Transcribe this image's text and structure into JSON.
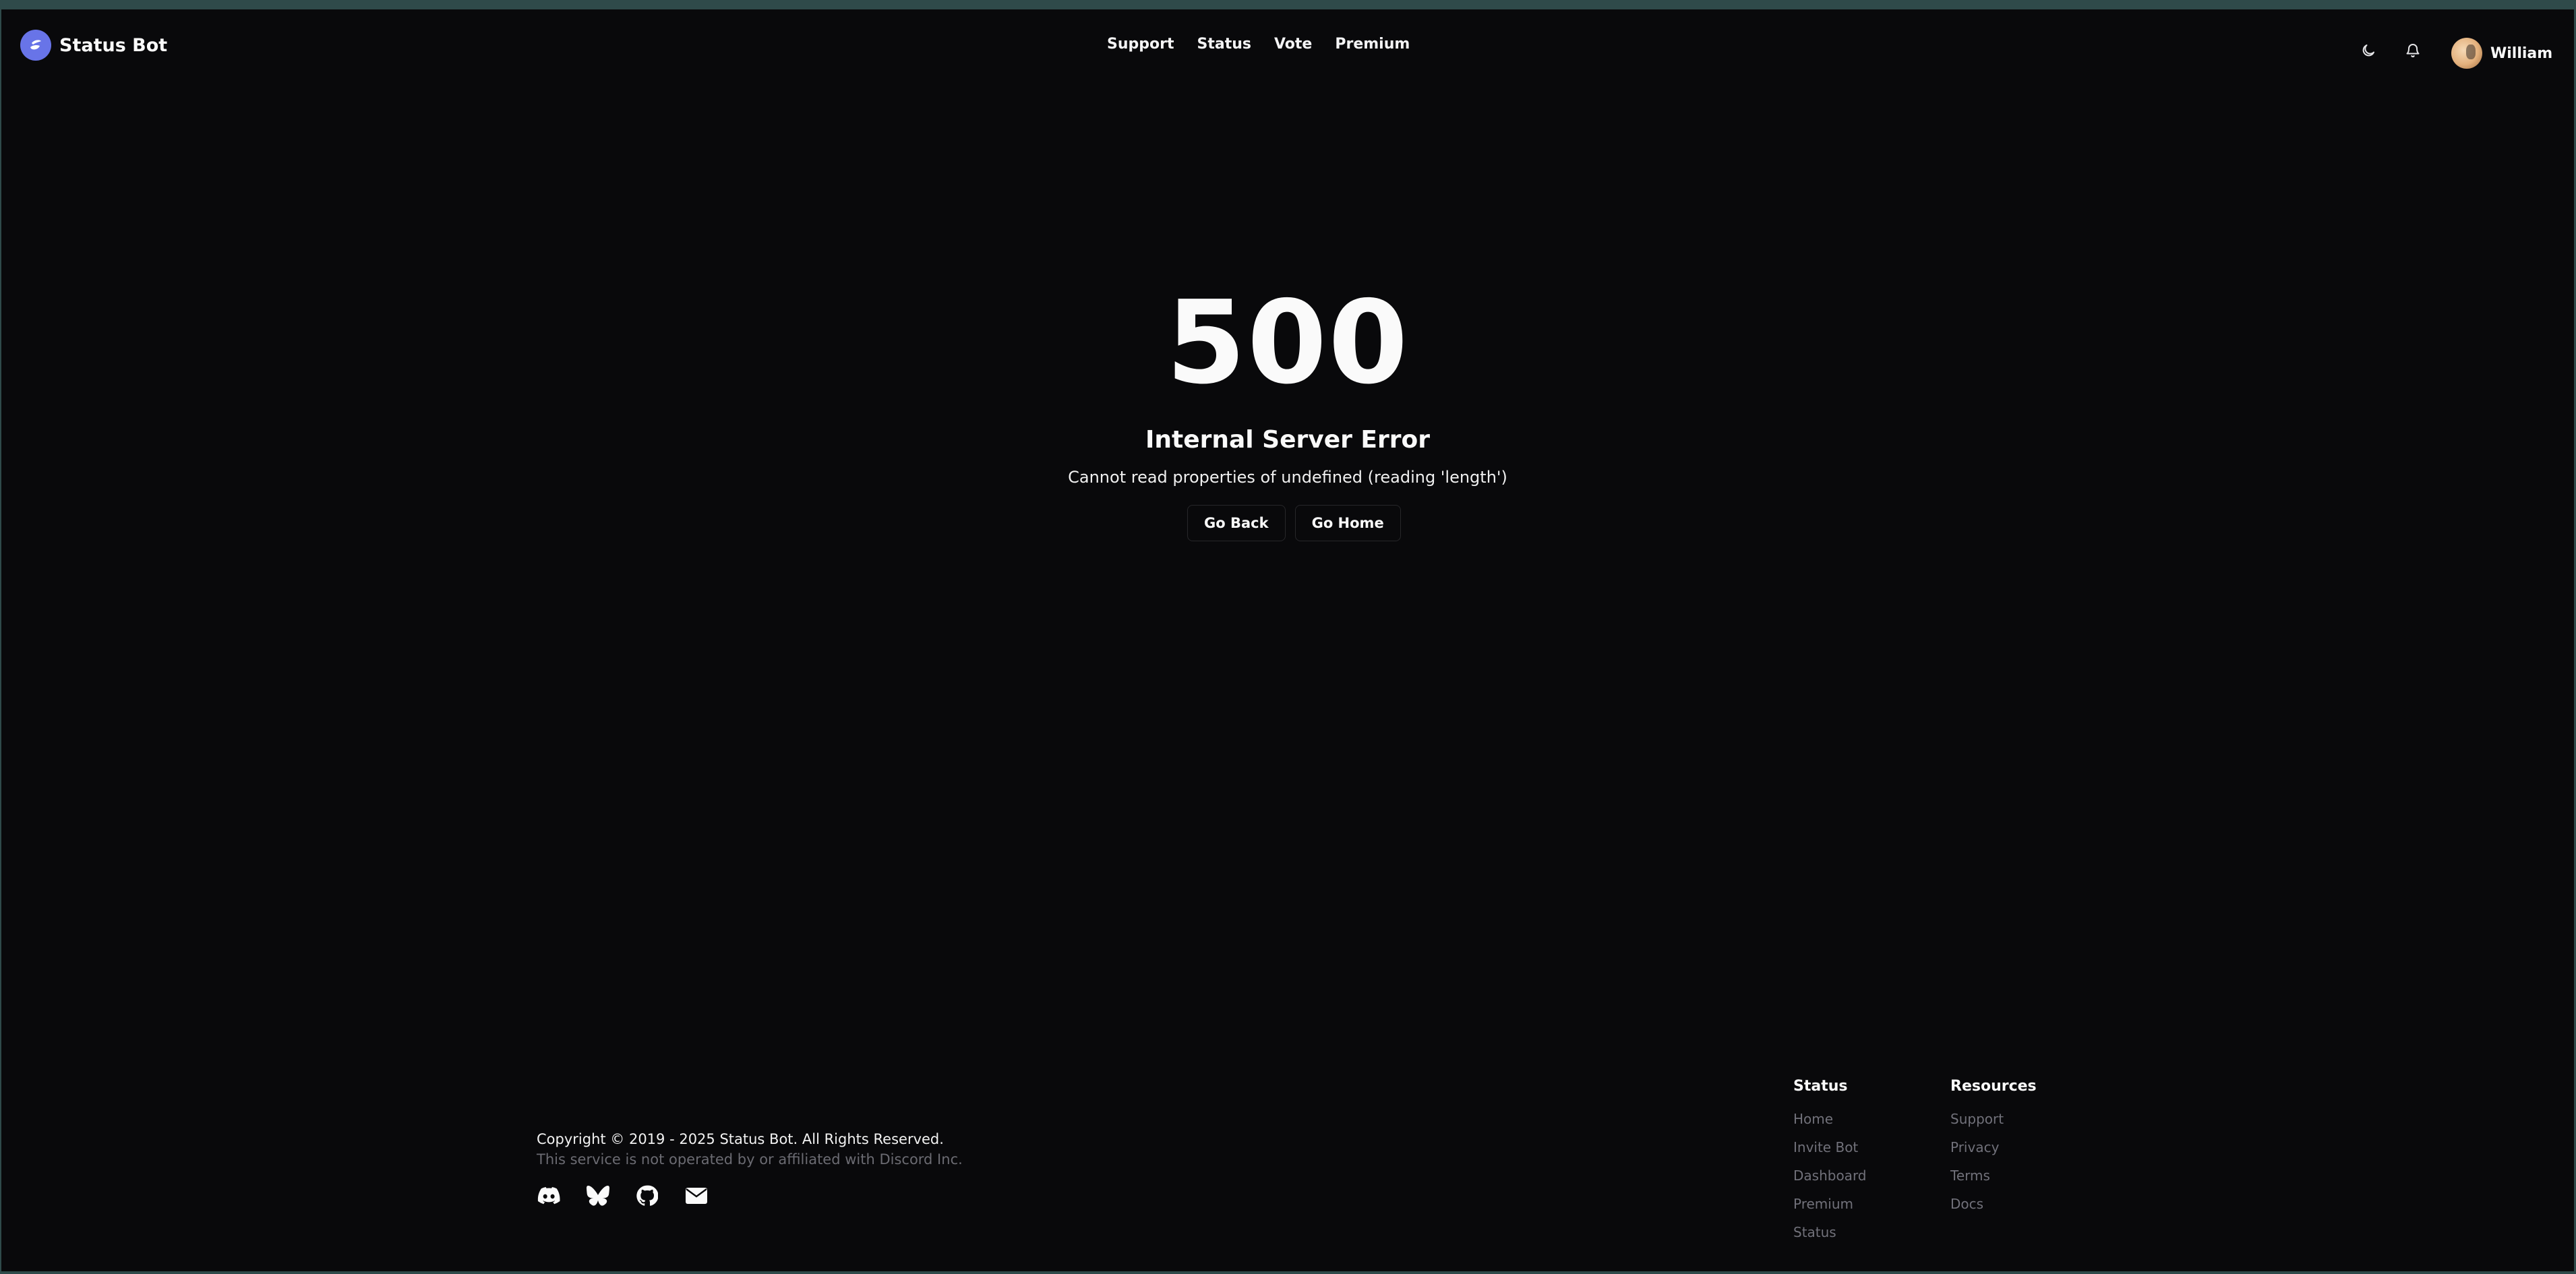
{
  "header": {
    "brand": "Status Bot",
    "nav": [
      "Support",
      "Status",
      "Vote",
      "Premium"
    ],
    "theme_icon": "moon-icon",
    "notifications_icon": "bell-icon",
    "user_name": "William"
  },
  "error": {
    "code": "500",
    "title": "Internal Server Error",
    "message": "Cannot read properties of undefined (reading 'length')",
    "back_label": "Go Back",
    "home_label": "Go Home"
  },
  "footer": {
    "copyright": "Copyright © 2019 - 2025 Status Bot. All Rights Reserved.",
    "disclaimer": "This service is not operated by or affiliated with Discord Inc.",
    "socials": [
      "discord-icon",
      "bluesky-icon",
      "github-icon",
      "mail-icon"
    ],
    "columns": [
      {
        "title": "Status",
        "links": [
          "Home",
          "Invite Bot",
          "Dashboard",
          "Premium",
          "Status"
        ]
      },
      {
        "title": "Resources",
        "links": [
          "Support",
          "Privacy",
          "Terms",
          "Docs"
        ]
      }
    ]
  },
  "colors": {
    "background": "#09090b",
    "brand_accent": "#6874e8",
    "muted_text": "#71717a"
  }
}
